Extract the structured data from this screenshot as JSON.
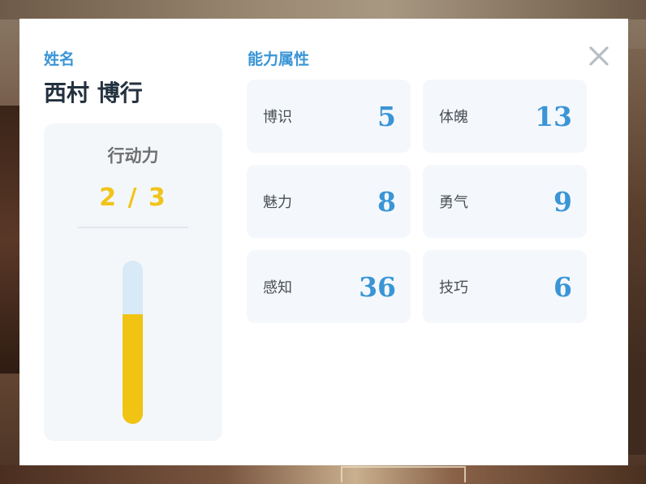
{
  "profile": {
    "name_label": "姓名",
    "name": "西村 博行"
  },
  "action_points": {
    "title": "行动力",
    "current": 2,
    "max": 3,
    "display": "2 / 3",
    "fill_fraction": 0.67
  },
  "attributes": {
    "title": "能力属性",
    "items": [
      {
        "label": "博识",
        "value": "5"
      },
      {
        "label": "体魄",
        "value": "13"
      },
      {
        "label": "魅力",
        "value": "8"
      },
      {
        "label": "勇气",
        "value": "9"
      },
      {
        "label": "感知",
        "value": "36"
      },
      {
        "label": "技巧",
        "value": "6"
      }
    ]
  },
  "close": {
    "icon": "close-icon"
  },
  "colors": {
    "accent": "#3a95d6",
    "name": "#23313f",
    "action_points": "#f1c41a",
    "bar_track": "#d8e9f7",
    "bar_fill": "#f1c313",
    "card_bg": "#f4f8fc",
    "close_icon": "#b7bec6"
  }
}
